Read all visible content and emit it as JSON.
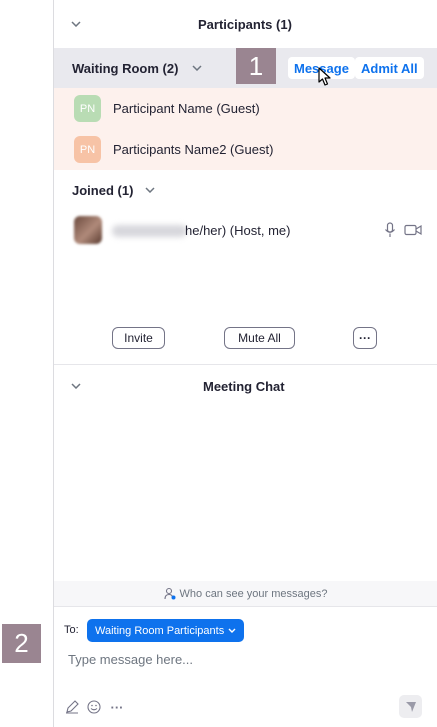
{
  "participants": {
    "title": "Participants (1)"
  },
  "waiting_room": {
    "title": "Waiting Room (2)",
    "message_label": "Message",
    "admit_all_label": "Admit All",
    "participants": [
      {
        "initials": "PN",
        "name": "Participant Name (Guest)",
        "color": "#b9dcb4"
      },
      {
        "initials": "PN",
        "name": "Participants Name2 (Guest)",
        "color": "#f7c3a6"
      }
    ]
  },
  "joined": {
    "title": "Joined (1)",
    "host_name_suffix": "he/her) (Host, me)"
  },
  "actions": {
    "invite_label": "Invite",
    "mute_all_label": "Mute All",
    "more_label": "···"
  },
  "chat": {
    "title": "Meeting Chat",
    "who_can_see": "Who can see your messages?",
    "to_label": "To:",
    "recipient": "Waiting Room Participants",
    "placeholder": "Type message here...",
    "more_label": "···"
  },
  "markers": [
    "1",
    "2"
  ],
  "colors": {
    "accent": "#0e72ed",
    "marker": "#9a8591",
    "waiting_bg": "#fdf1ed",
    "header_bg": "#e9e9ee"
  }
}
